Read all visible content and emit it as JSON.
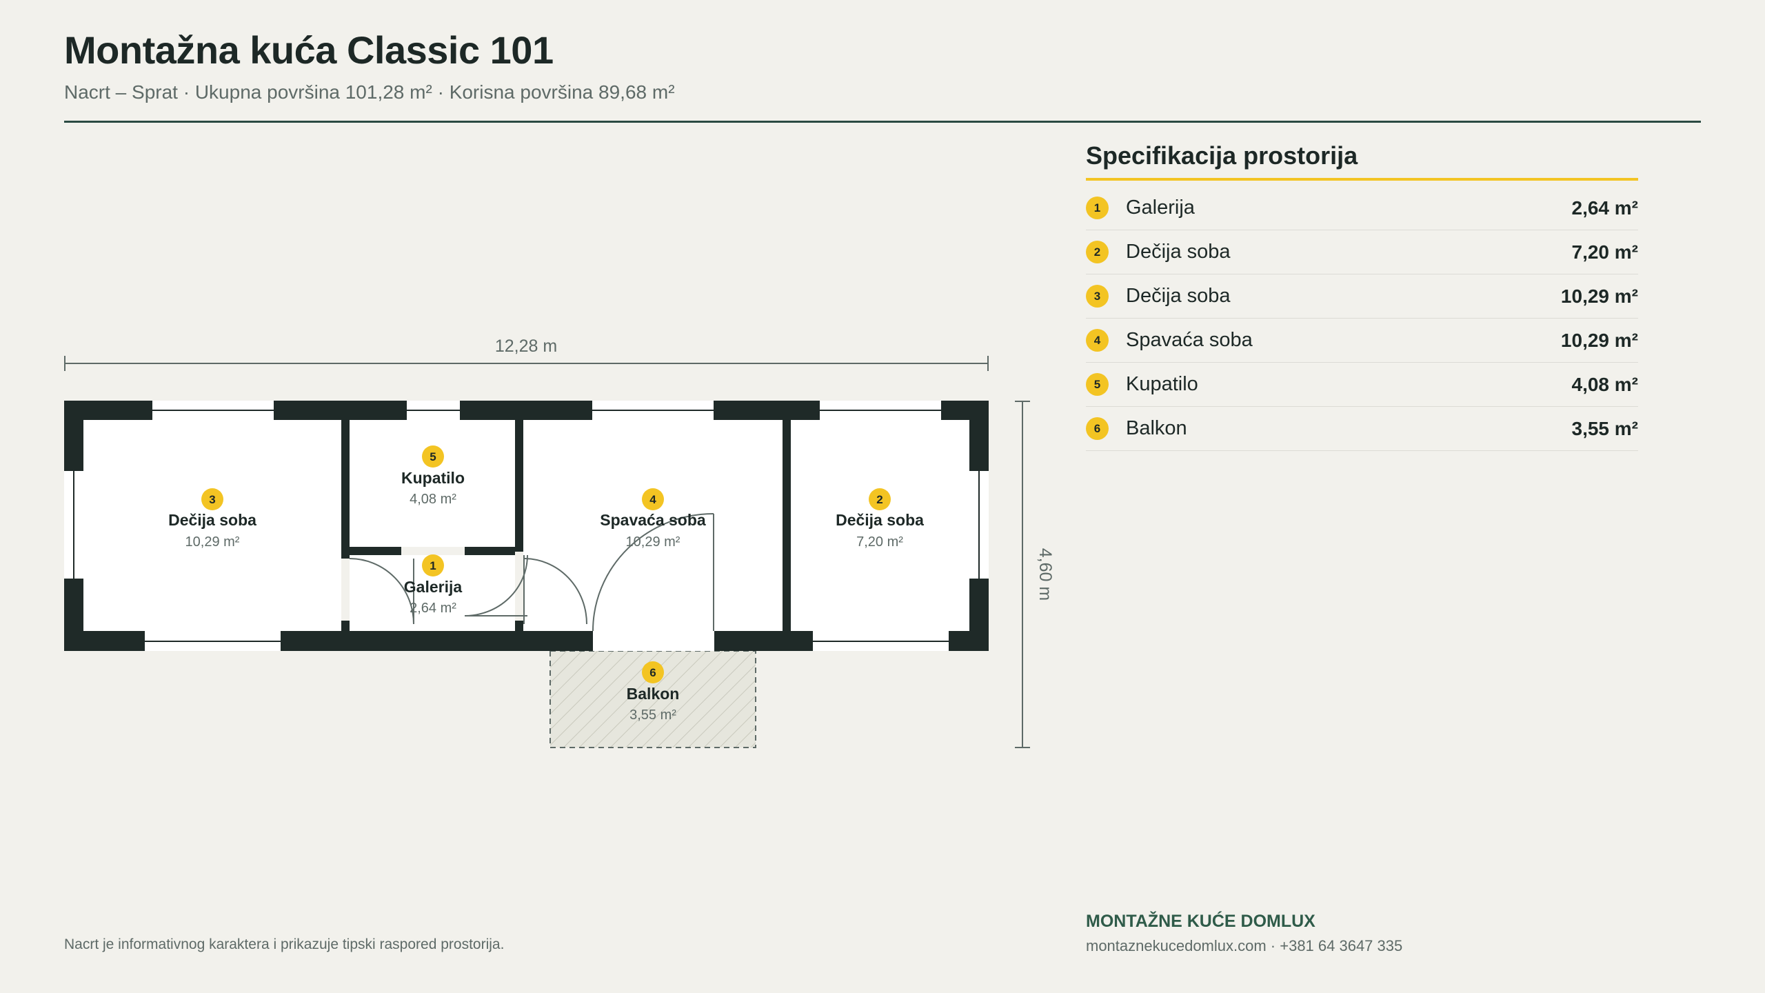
{
  "header": {
    "title": "Montažna kuća Classic 101",
    "subtitle": "Nacrt – Sprat · Ukupna površina 101,28 m² · Korisna površina 89,68 m²"
  },
  "plan": {
    "width_label": "12,28 m",
    "depth_label": "4,60 m",
    "rooms": [
      {
        "num": "1",
        "name": "Galerija",
        "area": "2,64 m²"
      },
      {
        "num": "2",
        "name": "Dečija soba",
        "area": "7,20 m²"
      },
      {
        "num": "3",
        "name": "Dečija soba",
        "area": "10,29 m²"
      },
      {
        "num": "4",
        "name": "Spavaća soba",
        "area": "10,29 m²"
      },
      {
        "num": "5",
        "name": "Kupatilo",
        "area": "4,08 m²"
      },
      {
        "num": "6",
        "name": "Balkon",
        "area": "3,55 m²"
      }
    ]
  },
  "spec": {
    "title": "Specifikacija prostorija",
    "rows": [
      {
        "num": "1",
        "name": "Galerija",
        "area": "2,64 m²"
      },
      {
        "num": "2",
        "name": "Dečija soba",
        "area": "7,20 m²"
      },
      {
        "num": "3",
        "name": "Dečija soba",
        "area": "10,29 m²"
      },
      {
        "num": "4",
        "name": "Spavaća soba",
        "area": "10,29 m²"
      },
      {
        "num": "5",
        "name": "Kupatilo",
        "area": "4,08 m²"
      },
      {
        "num": "6",
        "name": "Balkon",
        "area": "3,55 m²"
      }
    ]
  },
  "footer": {
    "disclaimer": "Nacrt je informativnog karaktera i prikazuje tipski raspored prostorija.",
    "brand": "MONTAŽNE KUĆE DOMLUX",
    "contact": "montaznekucedomlux.com · +381 64 3647 335"
  },
  "colors": {
    "background": "#f2f1ec",
    "wall": "#1f2a28",
    "accent_green": "#2b4a43",
    "badge_yellow": "#f3c423"
  }
}
